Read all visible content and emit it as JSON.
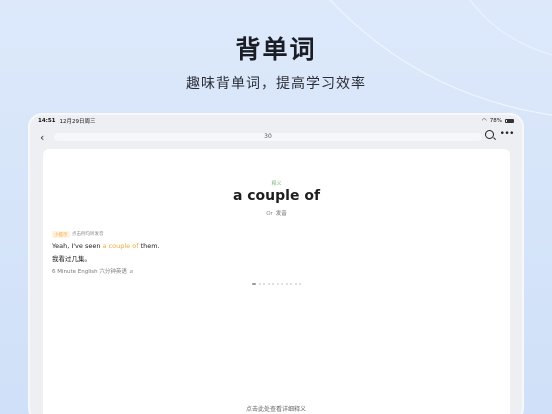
{
  "hero": {
    "title": "背单词",
    "subtitle": "趣味背单词，提高学习效率"
  },
  "statusbar": {
    "time": "14:51",
    "date": "12月29日周三",
    "battery": "78%"
  },
  "navbar": {
    "back_icon": "chevron-left-icon",
    "progress_count": "30",
    "search_icon": "search-icon",
    "more_icon": "more-icon"
  },
  "card": {
    "pos_tag": "释义",
    "word": "a couple of",
    "pron_prefix": "Or",
    "pron_label": "发音",
    "example": {
      "tag": "小提示",
      "hint": "点击例句听发音",
      "en_before": "Yeah, I've seen ",
      "en_highlight": "a couple of",
      "en_after": " them.",
      "zh": "我看过几集。",
      "source": "6 Minute English 六分钟英语"
    },
    "pagination": {
      "total": 11,
      "active_index": 0
    }
  },
  "footer": {
    "hint": "点击此处查看详细释义"
  },
  "colors": {
    "accent_orange": "#f2a93b",
    "pos_green": "#7fb87a",
    "background": "#dde9fb"
  }
}
